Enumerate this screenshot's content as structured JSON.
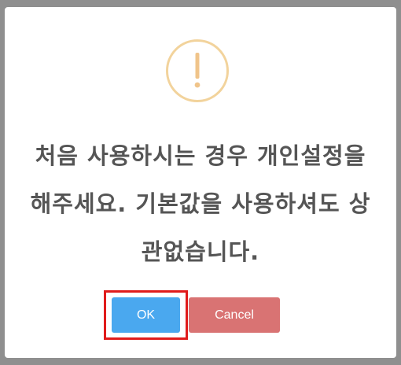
{
  "dialog": {
    "icon": "exclamation-icon",
    "message_lines": [
      "처음 사용하시는 경우 개인설정을",
      "해주세요. 기본값을 사용하셔도 상",
      "관없습니다."
    ],
    "ok_label": "OK",
    "cancel_label": "Cancel"
  },
  "colors": {
    "icon_ring": "#f2d39c",
    "icon_mark": "#f0c48a",
    "ok_button": "#4aa8ef",
    "cancel_button": "#d97373",
    "highlight_box": "#e01b1b",
    "overlay": "#8f8f8f"
  }
}
